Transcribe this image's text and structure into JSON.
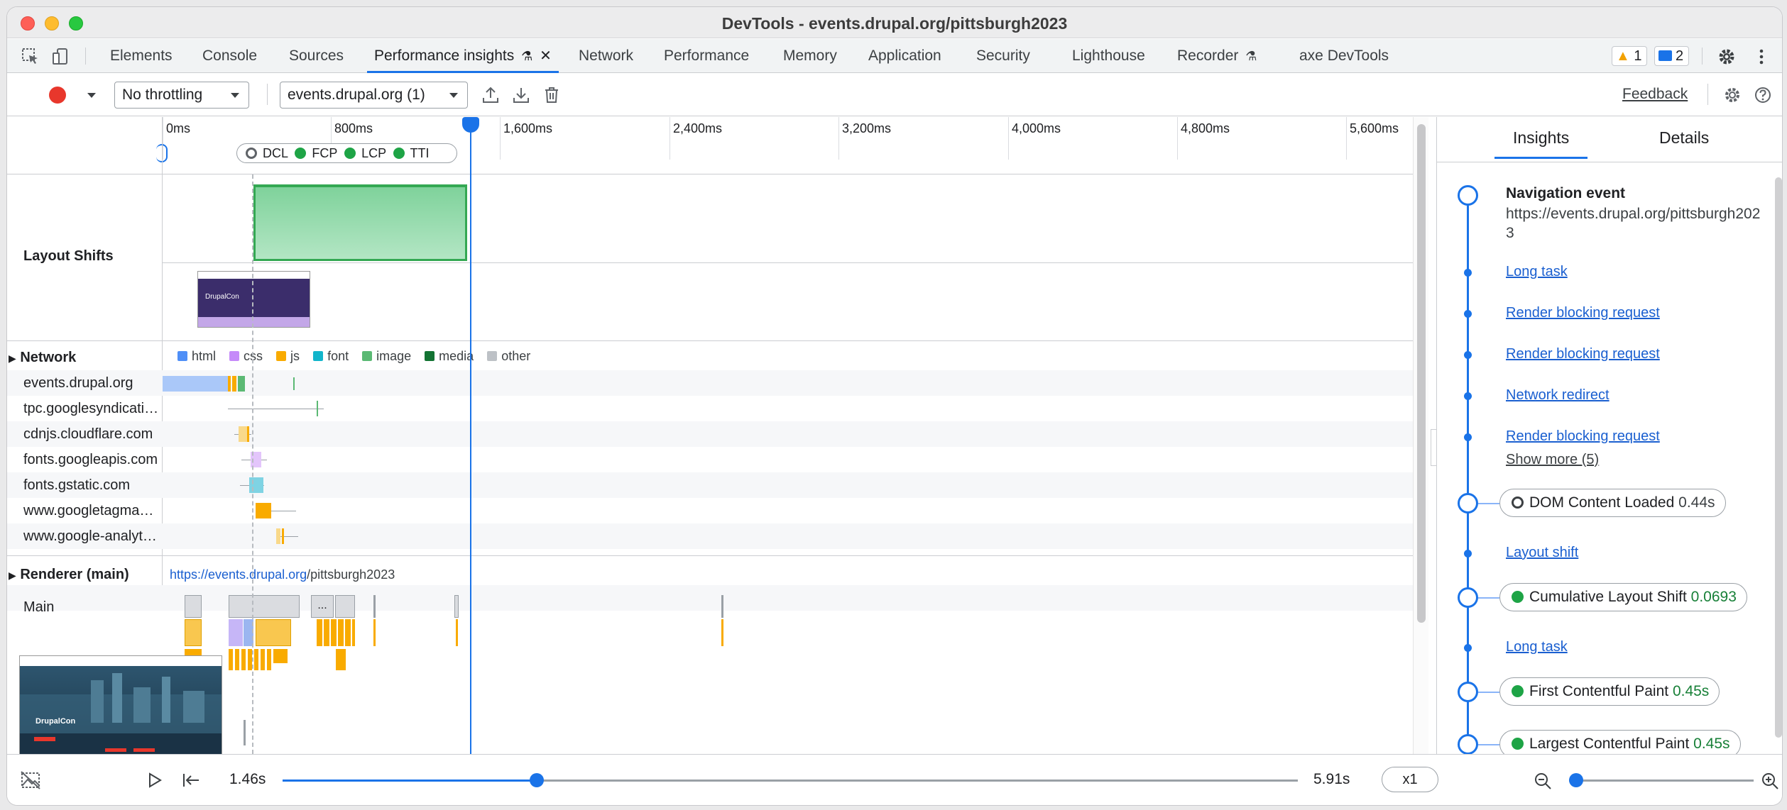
{
  "window": {
    "title": "DevTools - events.drupal.org/pittsburgh2023"
  },
  "tabs": [
    {
      "label": "Elements"
    },
    {
      "label": "Console"
    },
    {
      "label": "Sources"
    },
    {
      "label": "Performance insights"
    },
    {
      "label": "Network"
    },
    {
      "label": "Performance"
    },
    {
      "label": "Memory"
    },
    {
      "label": "Application"
    },
    {
      "label": "Security"
    },
    {
      "label": "Lighthouse"
    },
    {
      "label": "Recorder"
    },
    {
      "label": "axe DevTools"
    }
  ],
  "badges": {
    "warnings": "1",
    "messages": "2"
  },
  "toolbar": {
    "throttling": "No throttling",
    "recording": "events.drupal.org (1)",
    "feedback": "Feedback"
  },
  "ruler": {
    "ticks": [
      "0ms",
      "800ms",
      "1,600ms",
      "2,400ms",
      "3,200ms",
      "4,000ms",
      "4,800ms",
      "5,600ms"
    ],
    "milestones": {
      "dcl": "DCL",
      "fcp": "FCP",
      "lcp": "LCP",
      "tti": "TTI"
    }
  },
  "tracks": {
    "layout_shifts": "Layout Shifts",
    "network": "Network",
    "renderer": "Renderer (main)",
    "main": "Main",
    "renderer_url_host": "https://events.drupal.org",
    "renderer_url_path": "/pittsburgh2023"
  },
  "legend": [
    {
      "label": "html",
      "color": "#4f8ff7"
    },
    {
      "label": "css",
      "color": "#c58af9"
    },
    {
      "label": "js",
      "color": "#f9ab00"
    },
    {
      "label": "font",
      "color": "#12b5cb"
    },
    {
      "label": "image",
      "color": "#5bb974"
    },
    {
      "label": "media",
      "color": "#137333"
    },
    {
      "label": "other",
      "color": "#bdc1c6"
    }
  ],
  "network_rows": [
    "events.drupal.org",
    "tpc.googlesyndicati…",
    "cdnjs.cloudflare.com",
    "fonts.googleapis.com",
    "fonts.gstatic.com",
    "www.googletagma…",
    "www.google-analyt…"
  ],
  "main_block_label": "...",
  "thumbnails": {
    "small": {
      "brand": "DrupalCon"
    },
    "large": {
      "brand": "DrupalCon"
    }
  },
  "insights_panel": {
    "tabs": [
      "Insights",
      "Details"
    ],
    "navigation": {
      "title": "Navigation event",
      "url": "https://events.drupal.org/pittsburgh2023"
    },
    "links": {
      "long_task_1": "Long task",
      "render_blocking_1": "Render blocking request",
      "render_blocking_2": "Render blocking request",
      "network_redirect": "Network redirect",
      "render_blocking_3": "Render blocking request",
      "show_more": "Show more (5)",
      "layout_shift": "Layout shift",
      "long_task_2": "Long task"
    },
    "metrics": {
      "dcl": {
        "label": "DOM Content Loaded",
        "value": "0.44s"
      },
      "cls": {
        "label": "Cumulative Layout Shift",
        "value": "0.0693"
      },
      "fcp": {
        "label": "First Contentful Paint",
        "value": "0.45s"
      },
      "lcp": {
        "label": "Largest Contentful Paint",
        "value": "0.45s"
      }
    }
  },
  "playback": {
    "current": "1.46s",
    "total": "5.91s",
    "speed": "x1",
    "position": 0.25,
    "zoom": 0.04
  },
  "colors": {
    "accent": "#1a73e8",
    "record": "#e8372c",
    "good": "#1ea446",
    "layout_shift_fill": "#8fd7a8"
  }
}
